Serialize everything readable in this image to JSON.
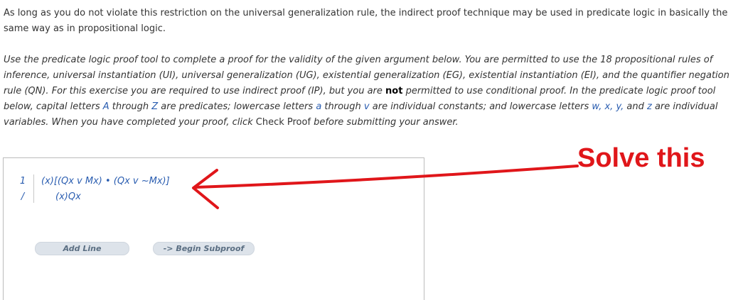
{
  "intro_text": "As long as you do not violate this restriction on the universal generalization rule, the indirect proof technique may be used in predicate logic in basically the same way as in propositional logic.",
  "instructions": {
    "part1": "Use the predicate logic proof tool to complete a proof for the validity of the given argument below. You are permitted to use the 18 propositional rules of inference, universal instantiation (UI), universal generalization (UG), existential generalization (EG), existential instantiation (EI), and the quantifier negation rule (QN). For this exercise you are required to use indirect proof (IP), but you are ",
    "not_word": "not",
    "part2": " permitted to use conditional proof. In the predicate logic proof tool below, capital letters ",
    "letter_A": "A",
    "through1": " through ",
    "letter_Z": "Z",
    "part3": " are predicates; lowercase letters ",
    "letter_a": "a",
    "through2": " through ",
    "letter_v": "v",
    "part4": " are individual constants; and lowercase letters ",
    "vars": "w, x, y,",
    "and_word": " and ",
    "letter_z": "z",
    "part5": " are individual variables. When you have completed your proof, click ",
    "check_proof": "Check Proof",
    "part6": " before submitting your answer."
  },
  "proof": {
    "premise_number": "1",
    "premise": "(x)[(Qx v Mx) • (Qx v ~Mx)]",
    "conclusion_marker": "/",
    "conclusion": "(x)Qx"
  },
  "buttons": {
    "add_line": "Add Line",
    "begin_subproof": "-> Begin Subproof"
  },
  "annotation": {
    "text": "Solve this",
    "color": "#e0161a"
  },
  "colors": {
    "link_blue": "#2a5db0",
    "button_bg": "#dde3ea",
    "button_text": "#5a6e82"
  }
}
